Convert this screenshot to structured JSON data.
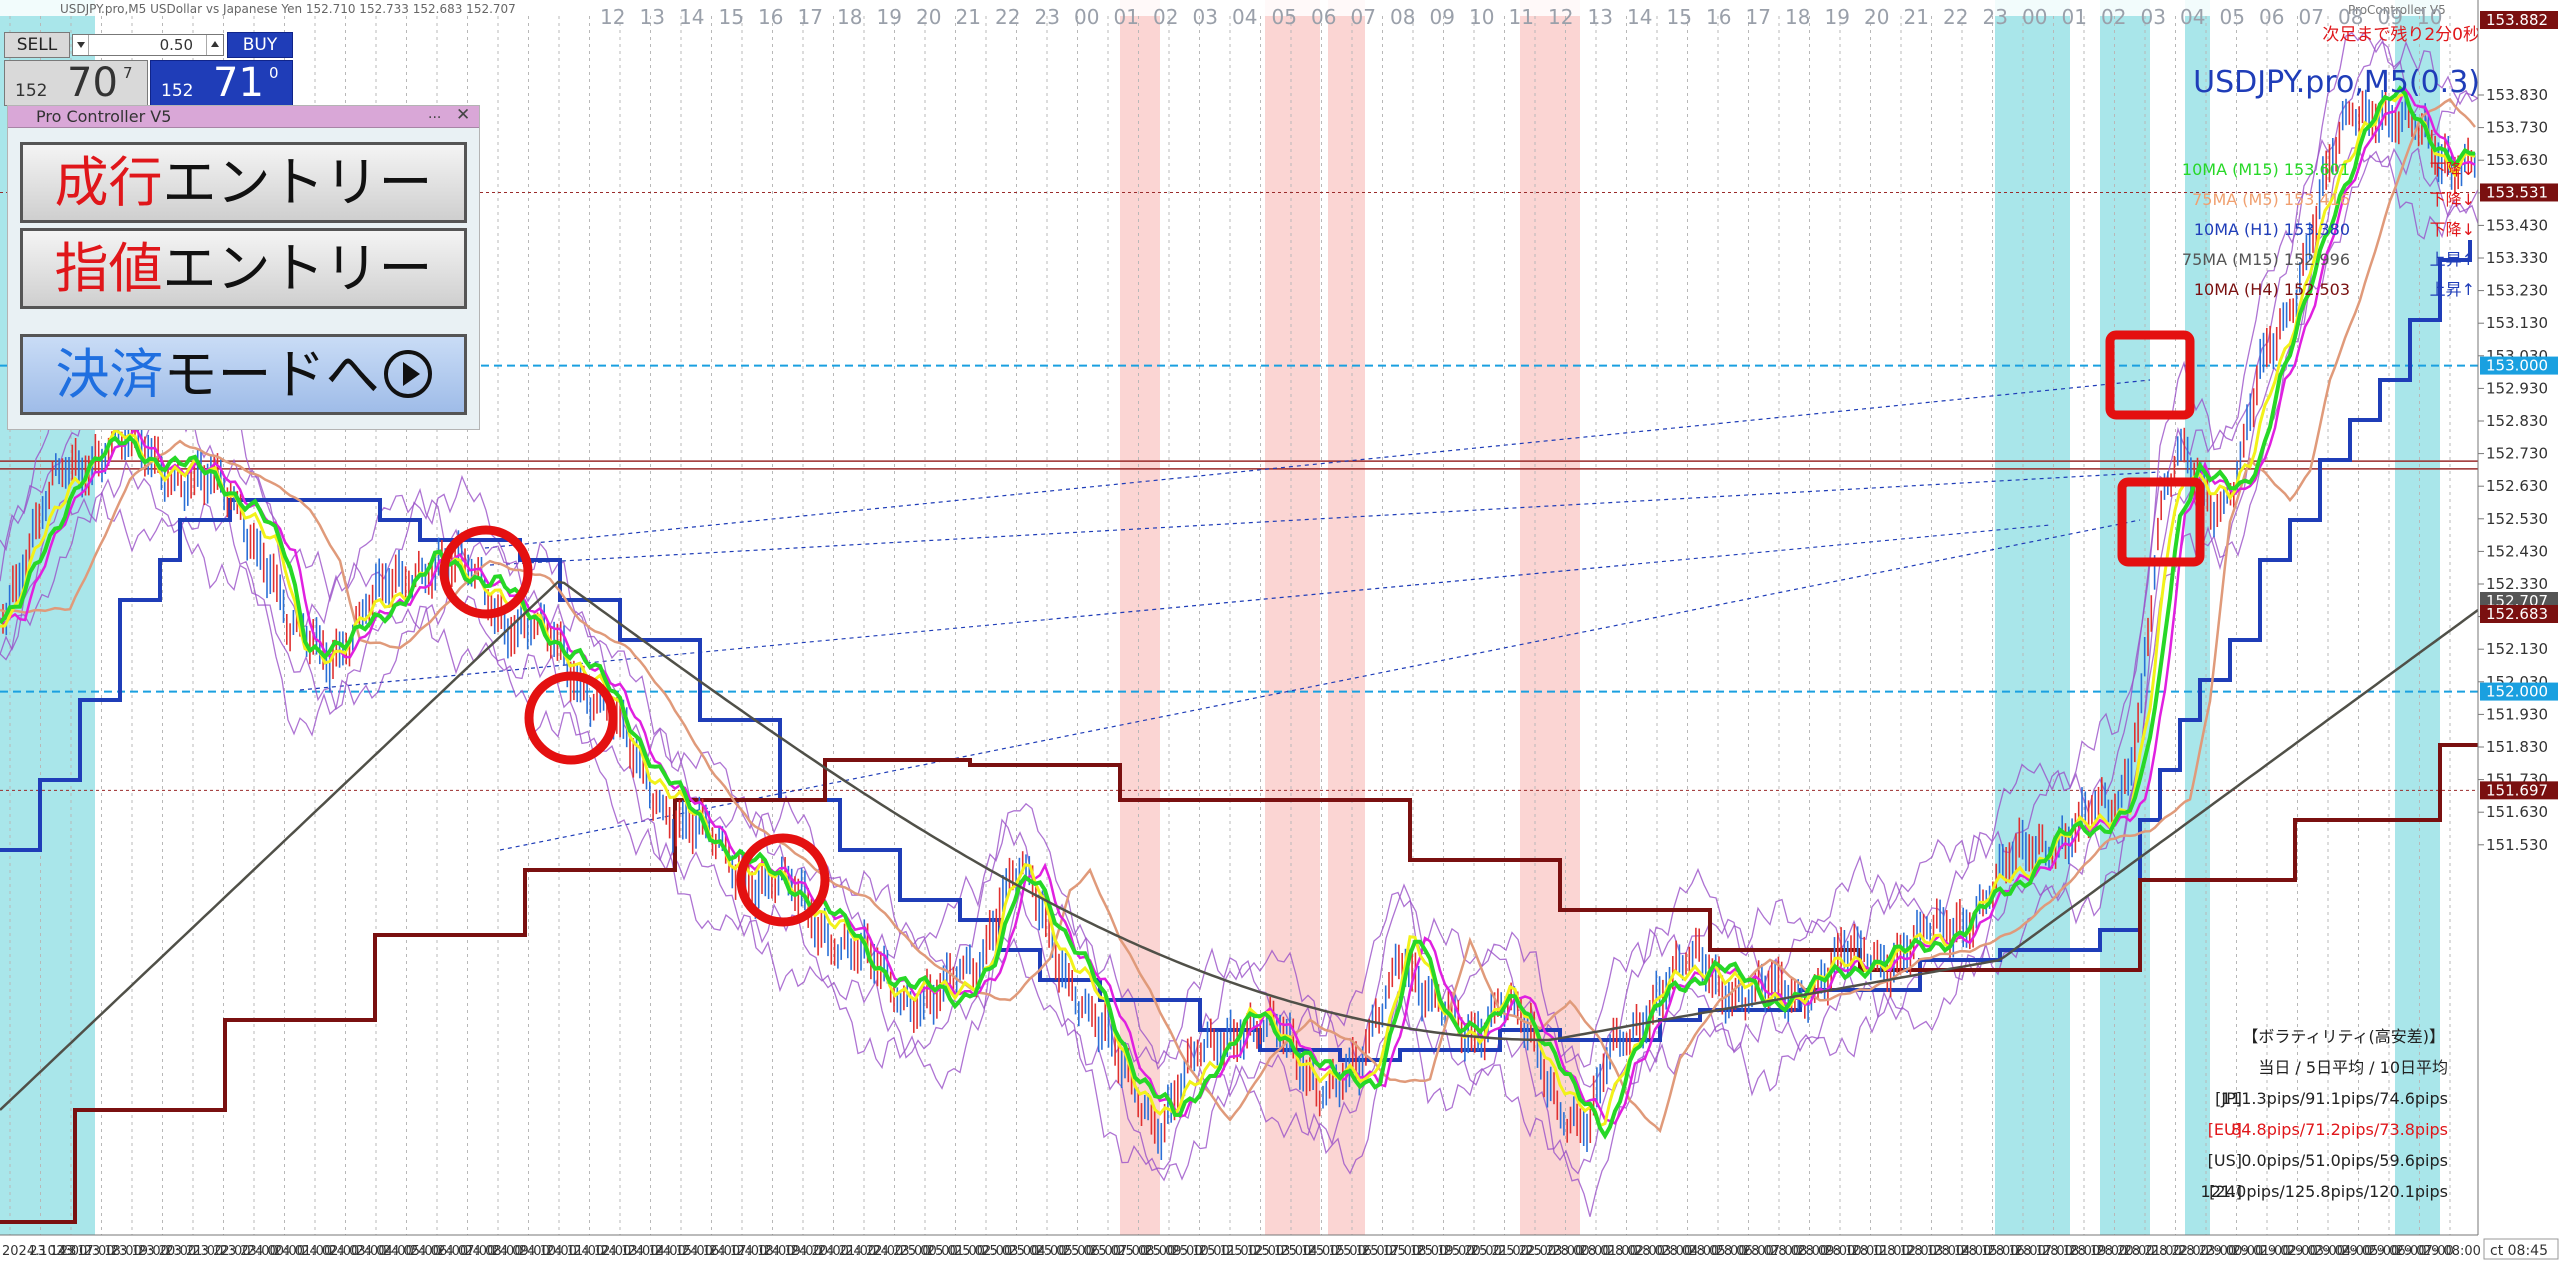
{
  "toolbar": {
    "window_title": "USDJPY.pro,M5  USDollar vs Japanese Yen  152.710 152.733 152.683 152.707",
    "top_right_label": "ProController V5"
  },
  "trade_panel": {
    "sell_label": "SELL",
    "buy_label": "BUY",
    "lot_value": "0.50",
    "bid_small": "152",
    "bid_big": "70",
    "bid_sup": "7",
    "ask_small": "152",
    "ask_big": "71",
    "ask_sup": "0"
  },
  "pro_controller": {
    "title": "Pro Controller V5",
    "minimize": "...",
    "close": "✕",
    "market_entry_a": "成行",
    "market_entry_b": "エントリー",
    "limit_entry_a": "指値",
    "limit_entry_b": "エントリー",
    "settle_mode_a": "決済",
    "settle_mode_b": "モードへ"
  },
  "info": {
    "countdown": "次足まで残り2分0秒",
    "symbol_timeframe": "USDJPY.pro,M5(0.3)",
    "ma_list": [
      {
        "label": "10MA (M15) 153.601",
        "status": "下降↓",
        "color": "#27d827",
        "status_color": "#e0161a"
      },
      {
        "label": "75MA (M5) 153.416",
        "status": "下降↓",
        "color": "#f0a070",
        "status_color": "#e0161a"
      },
      {
        "label": "10MA (H1) 153.380",
        "status": "下降↓",
        "color": "#1f3db8",
        "status_color": "#e0161a"
      },
      {
        "label": "75MA (M15) 152.996",
        "status": "上昇↑",
        "color": "#555555",
        "status_color": "#1f3db8"
      },
      {
        "label": "10MA (H4) 152.503",
        "status": "上昇↑",
        "color": "#7a1010",
        "status_color": "#1f3db8"
      }
    ]
  },
  "volatility": {
    "title": "【ボラティリティ(高安差)】",
    "header": "当日 / 5日平均 / 10日平均",
    "rows": [
      {
        "label": "[JP]",
        "value": "111.3pips/91.1pips/74.6pips",
        "color": "#222222"
      },
      {
        "label": "[EU]",
        "value": "84.8pips/71.2pips/73.8pips",
        "color": "#e0161a"
      },
      {
        "label": "[US]",
        "value": "0.0pips/51.0pips/59.6pips",
        "color": "#222222"
      },
      {
        "label": "[24]",
        "value": "121.0pips/125.8pips/120.1pips",
        "color": "#222222"
      }
    ]
  },
  "price_axis": {
    "ticks": [
      "153.830",
      "153.730",
      "153.630",
      "153.530",
      "153.430",
      "153.330",
      "153.230",
      "153.130",
      "153.030",
      "152.930",
      "152.830",
      "152.730",
      "152.630",
      "152.530",
      "152.430",
      "152.330",
      "152.230",
      "152.130",
      "152.030",
      "151.930",
      "151.830",
      "151.730",
      "151.630",
      "151.530"
    ],
    "markers": [
      {
        "value": "153.882",
        "bg": "#7a1010"
      },
      {
        "value": "153.531",
        "bg": "#7a1010"
      },
      {
        "value": "153.000",
        "bg": "#1aa0e0"
      },
      {
        "value": "152.707",
        "bg": "#555555"
      },
      {
        "value": "152.683",
        "bg": "#7a1010"
      },
      {
        "value": "152.000",
        "bg": "#1aa0e0"
      },
      {
        "value": "151.697",
        "bg": "#7a1010"
      }
    ]
  },
  "time_axis": {
    "labels": [
      "2024.10.23",
      "23 14:00",
      "23 17:00",
      "23 18:00",
      "23 19:00",
      "23 20:00",
      "23 21:00",
      "23 22:00",
      "23 23:00",
      "24 00:00",
      "24 01:00",
      "24 02:00",
      "24 03:00",
      "24 04:00",
      "24 05:00",
      "24 06:00",
      "24 07:00",
      "24 08:00",
      "24 09:00",
      "24 10:00",
      "24 11:00",
      "24 12:00",
      "24 13:00",
      "24 14:00",
      "24 15:00",
      "24 16:00",
      "24 17:00",
      "24 18:00",
      "24 19:00",
      "24 20:00",
      "24 21:00",
      "24 22:00",
      "24 23:00",
      "25 00:00",
      "25 01:00",
      "25 02:00",
      "25 03:00",
      "25 04:00",
      "25 05:00",
      "25 06:00",
      "25 07:00",
      "25 08:00",
      "25 09:00",
      "25 10:00",
      "25 11:00",
      "25 12:00",
      "25 13:00",
      "25 14:00",
      "25 15:00",
      "25 16:00",
      "25 17:00",
      "25 18:00",
      "25 19:00",
      "25 20:00",
      "25 21:00",
      "25 22:00",
      "25 23:00",
      "28 00:00",
      "28 01:00",
      "28 02:00",
      "28 03:00",
      "28 04:00",
      "28 05:00",
      "28 06:00",
      "28 07:00",
      "28 08:00",
      "28 09:00",
      "28 10:00",
      "28 11:00",
      "28 12:00",
      "28 13:00",
      "28 14:00",
      "28 15:00",
      "28 16:00",
      "28 17:00",
      "28 18:00",
      "28 19:00",
      "28 20:00",
      "28 21:00",
      "28 22:00",
      "28 23:00",
      "29 00:00",
      "29 01:00",
      "29 02:00",
      "29 03:00",
      "29 04:00",
      "29 05:00",
      "29 06:00",
      "29 07:00",
      "29 08:00"
    ],
    "cursor_label": "ct 08:45"
  },
  "top_hours": [
    "12",
    "13",
    "14",
    "15",
    "16",
    "17",
    "18",
    "19",
    "20",
    "21",
    "22",
    "23",
    "00",
    "01",
    "02",
    "03",
    "04",
    "05",
    "06",
    "07",
    "08",
    "09",
    "10",
    "11",
    "12",
    "13",
    "14",
    "15",
    "16",
    "17",
    "18",
    "19",
    "20",
    "21",
    "22",
    "23",
    "00",
    "01",
    "02",
    "03",
    "04",
    "05",
    "06",
    "07",
    "08",
    "09",
    "10"
  ],
  "colors": {
    "session_cyan": "#a9e6ea",
    "session_pink": "#fbd5d3",
    "ma_green": "#27d827",
    "ma_yellow": "#f2f21a",
    "ma_magenta": "#e020e0",
    "ma_salmon": "#e09a7a",
    "ma_dark": "#505048",
    "step_blue": "#1f3db8",
    "step_maroon": "#7a1010",
    "envelope_purple": "#9a50c8",
    "level_cyan": "#1aa0e0",
    "level_red": "#9a2a2a",
    "annotation_red": "#e41010"
  }
}
